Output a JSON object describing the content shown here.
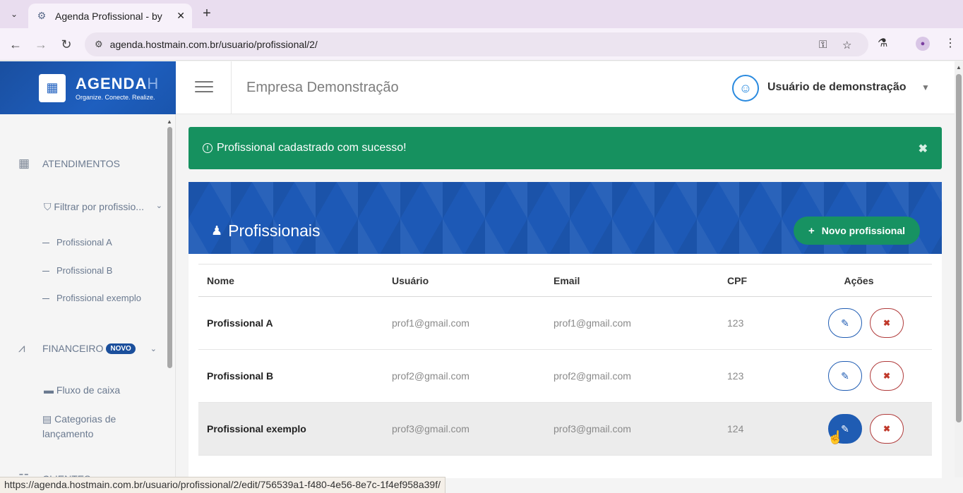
{
  "browser": {
    "tab_title": "Agenda Profissional - by",
    "url": "agenda.hostmain.com.br/usuario/profissional/2/",
    "status_url": "https://agenda.hostmain.com.br/usuario/profissional/2/edit/756539a1-f480-4e56-8e7c-1f4ef958a39f/"
  },
  "brand": {
    "name": "AGENDA",
    "name_suffix": "H",
    "tagline": "Organize. Conecte. Realize."
  },
  "header": {
    "company": "Empresa Demonstração",
    "user_name": "Usuário de demonstração"
  },
  "sidebar": {
    "atendimentos_label": "ATENDIMENTOS",
    "filter_label": "Filtrar por profissio...",
    "professionals": [
      "Profissional A",
      "Profissional B",
      "Profissional exemplo"
    ],
    "financeiro_label": "FINANCEIRO",
    "financeiro_badge": "NOVO",
    "fluxo_label": "Fluxo de caixa",
    "categorias_label": "Categorias de lançamento",
    "clientes_label": "CLIENTES"
  },
  "alert": {
    "message": "Profissional cadastrado com sucesso!"
  },
  "card": {
    "title": "Profissionais",
    "new_button": "Novo profissional"
  },
  "table": {
    "headers": {
      "nome": "Nome",
      "usuario": "Usuário",
      "email": "Email",
      "cpf": "CPF",
      "acoes": "Ações"
    },
    "rows": [
      {
        "nome": "Profissional A",
        "usuario": "prof1@gmail.com",
        "email": "prof1@gmail.com",
        "cpf": "123"
      },
      {
        "nome": "Profissional B",
        "usuario": "prof2@gmail.com",
        "email": "prof2@gmail.com",
        "cpf": "123"
      },
      {
        "nome": "Profissional exemplo",
        "usuario": "prof3@gmail.com",
        "email": "prof3@gmail.com",
        "cpf": "124"
      }
    ]
  },
  "colors": {
    "brand_blue": "#1e5fbf",
    "success_green": "#16915f",
    "danger_red": "#c0392b"
  }
}
